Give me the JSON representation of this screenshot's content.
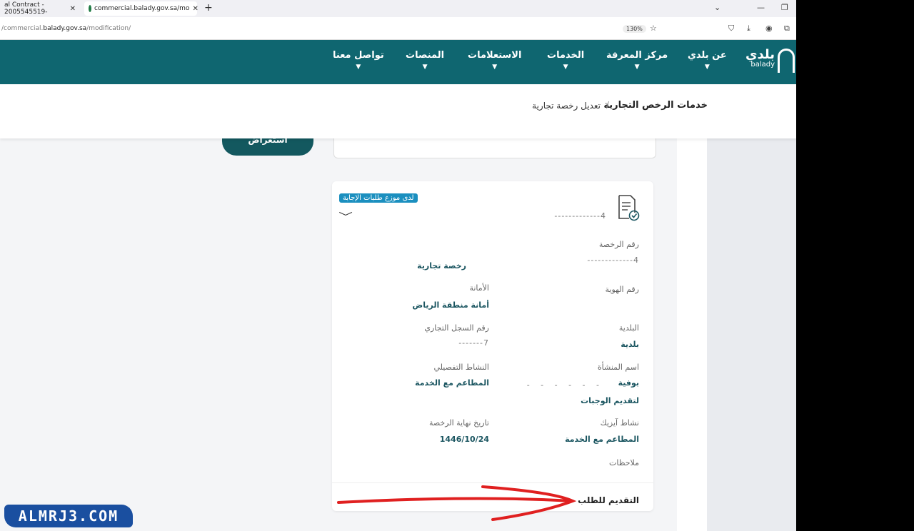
{
  "browser": {
    "tabs": [
      {
        "label": "al Contract - 2005545519-"
      },
      {
        "label": "commercial.balady.gov.sa/mo"
      }
    ],
    "url_prefix": "/commercial.",
    "url_host": "balady.gov.sa",
    "url_path": "/modification/",
    "zoom": "130%"
  },
  "nav": {
    "logo_ar": "بلدي",
    "logo_en": "balady",
    "items": [
      {
        "label": "عن بلدي"
      },
      {
        "label": "مركز المعرفة"
      },
      {
        "label": "الخدمات"
      },
      {
        "label": "الاستعلامات"
      },
      {
        "label": "المنصات"
      },
      {
        "label": "تواصل معنا"
      }
    ]
  },
  "breadcrumb": {
    "parent": "خدمات الرخص التجارية",
    "separator": "/",
    "current": "تعديل رخصة تجارية"
  },
  "preview_button": "استعراض",
  "card": {
    "status_badge": "لدى موزع طلبات الإجابة",
    "header_number_masked": "4-------------",
    "fields": {
      "license_number_label": "رقم الرخصة",
      "license_number_value": "4-------------",
      "license_type_value": "رخصة تجارية",
      "id_number_label": "رقم الهوية",
      "amanah_label": "الأمانة",
      "amanah_value": "أمانة منطقة الرياض",
      "municipality_label": "البلدية",
      "municipality_value": "بلدية",
      "cr_number_label": "رقم السجل التجاري",
      "cr_number_value": "7-------",
      "establishment_label": "اسم المنشأة",
      "establishment_value": "بوفية",
      "detailed_activity_label": "النشاط التفصيلي",
      "detailed_activity_value": "المطاعم مع الخدمة",
      "establishment_value_2": "لتقديم الوجبات",
      "isic_label": "نشاط آيزيك",
      "isic_value": "المطاعم مع الخدمة",
      "expiry_label": "تاريخ نهاية الرخصة",
      "expiry_value": "1446/10/24",
      "notes_label": "ملاحظات"
    },
    "apply_label": "التقديم للطلب"
  },
  "watermark": "ALMRJ3.COM",
  "colors": {
    "nav_bg": "#0f6670",
    "value_text": "#1a5560",
    "status_badge": "#1b8fbf",
    "annotation_arrow": "#e02020"
  }
}
